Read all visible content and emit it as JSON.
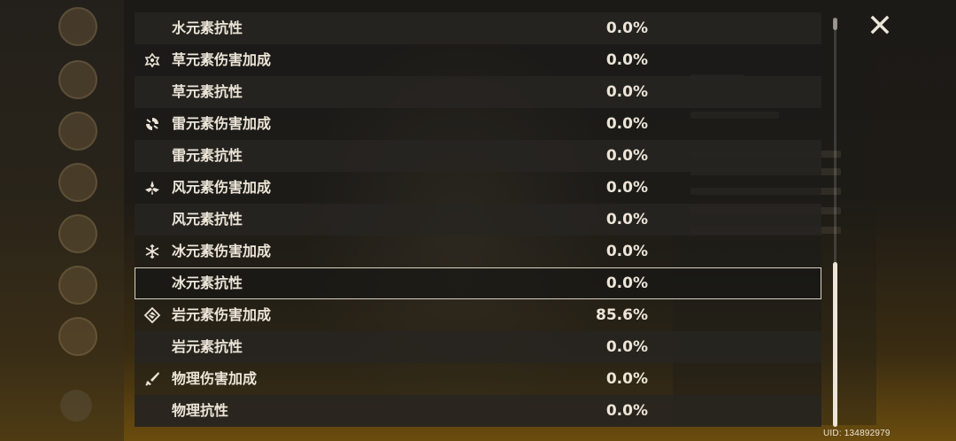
{
  "stats": [
    {
      "label": "水元素抗性",
      "value": "0.0%",
      "icon": ""
    },
    {
      "label": "草元素伤害加成",
      "value": "0.0%",
      "icon": "dendro-icon"
    },
    {
      "label": "草元素抗性",
      "value": "0.0%",
      "icon": ""
    },
    {
      "label": "雷元素伤害加成",
      "value": "0.0%",
      "icon": "electro-icon"
    },
    {
      "label": "雷元素抗性",
      "value": "0.0%",
      "icon": ""
    },
    {
      "label": "风元素伤害加成",
      "value": "0.0%",
      "icon": "anemo-icon"
    },
    {
      "label": "风元素抗性",
      "value": "0.0%",
      "icon": ""
    },
    {
      "label": "冰元素伤害加成",
      "value": "0.0%",
      "icon": "cryo-icon"
    },
    {
      "label": "冰元素抗性",
      "value": "0.0%",
      "icon": ""
    },
    {
      "label": "岩元素伤害加成",
      "value": "85.6%",
      "icon": "geo-icon"
    },
    {
      "label": "岩元素抗性",
      "value": "0.0%",
      "icon": ""
    },
    {
      "label": "物理伤害加成",
      "value": "0.0%",
      "icon": "physical-icon"
    },
    {
      "label": "物理抗性",
      "value": "0.0%",
      "icon": ""
    }
  ],
  "selected_index": 8,
  "uid": "UID: 134892979",
  "colors": {
    "text": "#ece5d8",
    "accent_bg": "#6a4c0e"
  }
}
